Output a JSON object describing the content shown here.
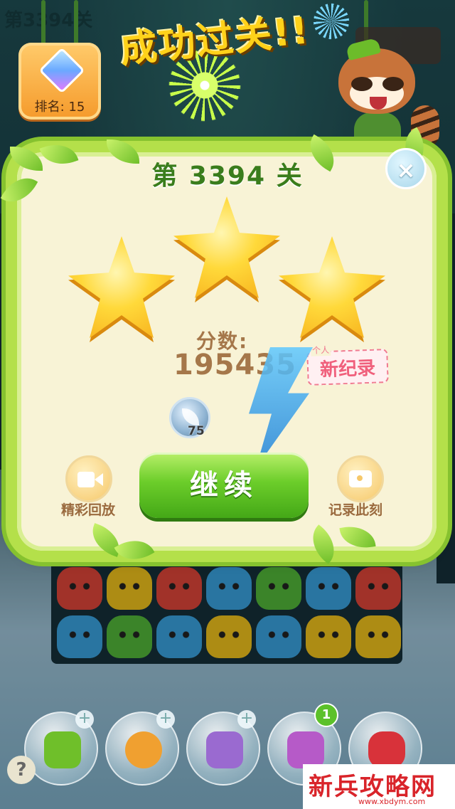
{
  "hud": {
    "level_top": "第3394关",
    "rank_label": "排名: 15"
  },
  "banner": {
    "title": "成功过关!!"
  },
  "dialog": {
    "level_title": "第 3394 关",
    "close_symbol": "×",
    "stars_earned": 3,
    "stars_total": 3,
    "score_label": "分数:",
    "score_value": "195435",
    "record_small": "个人",
    "record_text": "新纪录",
    "coin_count": "75",
    "replay_label": "精彩回放",
    "snapshot_label": "记录此刻",
    "continue_label": "继续"
  },
  "boosters": {
    "badge_count": "1",
    "help_symbol": "?"
  },
  "watermark": {
    "name": "新兵攻略网",
    "url": "www.xbdym.com"
  },
  "colors": {
    "accent_green": "#6ccd2a",
    "star_gold": "#ffd93a",
    "score_brown": "#a5774a",
    "record_pink": "#f0607c"
  }
}
